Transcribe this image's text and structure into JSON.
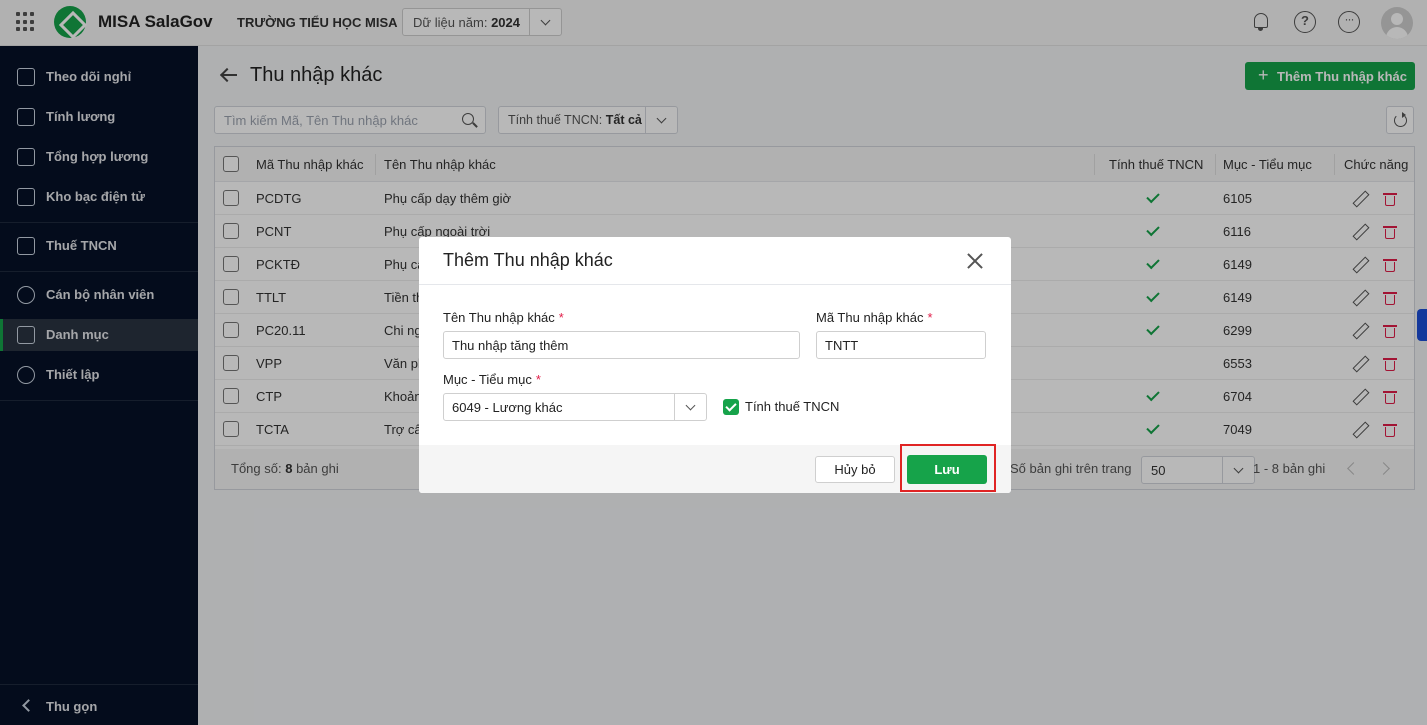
{
  "header": {
    "app_name": "MISA SalaGov",
    "school": "TRƯỜNG TIỂU HỌC MISA",
    "year_label": "Dữ liệu năm:",
    "year_value": "2024",
    "help_glyph": "?",
    "more_glyph": "···"
  },
  "sidebar": {
    "items": [
      {
        "label": "Theo dõi nghỉ",
        "icon": "calendar-icon"
      },
      {
        "label": "Tính lương",
        "icon": "wallet-icon"
      },
      {
        "label": "Tổng hợp lương",
        "icon": "payroll-summary-icon"
      },
      {
        "label": "Kho bạc điện tử",
        "icon": "treasury-icon"
      },
      {
        "label": "Thuế TNCN",
        "icon": "tax-icon"
      },
      {
        "label": "Cán bộ nhân viên",
        "icon": "staff-icon"
      },
      {
        "label": "Danh mục",
        "icon": "catalog-icon"
      },
      {
        "label": "Thiết lập",
        "icon": "settings-icon"
      }
    ],
    "collapse_label": "Thu gọn"
  },
  "page": {
    "title": "Thu nhập khác",
    "add_button": "Thêm Thu nhập khác",
    "search_placeholder": "Tìm kiếm Mã, Tên Thu nhập khác",
    "filter_label": "Tính thuế TNCN:",
    "filter_value": "Tất cả"
  },
  "table": {
    "columns": [
      "Mã Thu nhập khác",
      "Tên Thu nhập khác",
      "Tính thuế TNCN",
      "Mục - Tiểu mục",
      "Chức năng"
    ],
    "rows": [
      {
        "code": "PCDTG",
        "name": "Phụ cấp dạy thêm giờ",
        "taxable": true,
        "muc": "6105"
      },
      {
        "code": "PCNT",
        "name": "Phụ cấp ngoài trời",
        "taxable": true,
        "muc": "6116"
      },
      {
        "code": "PCKTĐ",
        "name": "Phụ cấ",
        "taxable": true,
        "muc": "6149"
      },
      {
        "code": "TTLT",
        "name": "Tiền th",
        "taxable": true,
        "muc": "6149"
      },
      {
        "code": "PC20.11",
        "name": "Chi ng",
        "taxable": true,
        "muc": "6299"
      },
      {
        "code": "VPP",
        "name": "Văn ph",
        "taxable": false,
        "muc": "6553"
      },
      {
        "code": "CTP",
        "name": "Khoản",
        "taxable": true,
        "muc": "6704"
      },
      {
        "code": "TCTA",
        "name": "Trợ cấ",
        "taxable": true,
        "muc": "7049"
      }
    ],
    "footer": {
      "total_prefix": "Tổng số:",
      "total_count": "8",
      "total_suffix": "bản ghi",
      "per_page_label": "Số bản ghi trên trang",
      "per_page_value": "50",
      "range": "1 - 8 bản ghi"
    }
  },
  "modal": {
    "title": "Thêm Thu nhập khác",
    "name_label": "Tên Thu nhập khác",
    "name_value": "Thu nhập tăng thêm",
    "code_label": "Mã Thu nhập khác",
    "code_value": "TNTT",
    "muc_label": "Mục - Tiểu mục",
    "muc_value": "6049 - Lương khác",
    "taxable_label": "Tính thuế TNCN",
    "taxable_checked": true,
    "required_mark": "*",
    "cancel_label": "Hủy bỏ",
    "save_label": "Lưu"
  },
  "colors": {
    "accent": "#16a34a",
    "sidebar_bg": "#061127",
    "delete": "#e11d48",
    "highlight": "#e02424"
  }
}
